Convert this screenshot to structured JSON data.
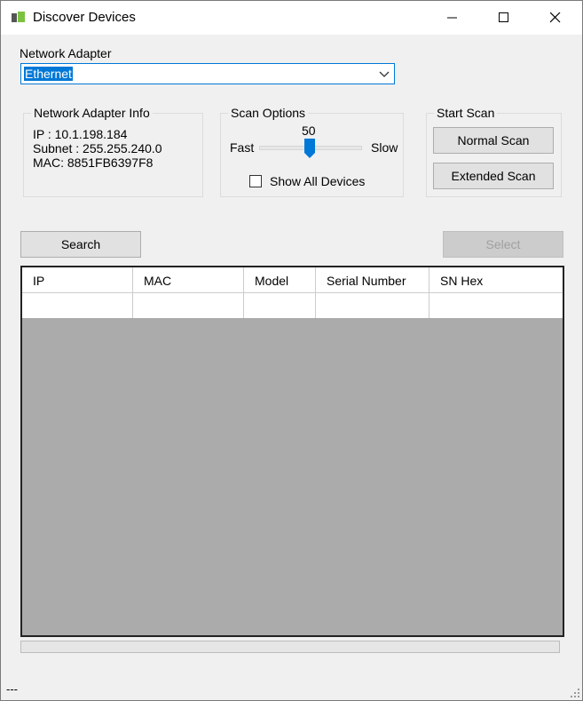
{
  "window": {
    "title": "Discover Devices",
    "minimize_glyph": "—",
    "maximize_glyph": "☐",
    "close_glyph": "✕"
  },
  "network_adapter": {
    "label": "Network Adapter",
    "selected": "Ethernet",
    "icon": "chevron-down-icon"
  },
  "adapter_info": {
    "title": "Network Adapter Info",
    "ip": "IP : 10.1.198.184",
    "subnet": "Subnet : 255.255.240.0",
    "mac": "MAC: 8851FB6397F8"
  },
  "scan_options": {
    "title": "Scan Options",
    "slider_value": "50",
    "slider_level": 0.5,
    "min_label": "Fast",
    "max_label": "Slow",
    "show_all_label": "Show All Devices",
    "show_all_checked": false
  },
  "start_scan": {
    "title": "Start Scan",
    "normal_label": "Normal Scan",
    "extended_label": "Extended Scan"
  },
  "actions": {
    "search_label": "Search",
    "select_label": "Select"
  },
  "grid": {
    "columns": [
      "IP",
      "MAC",
      "Model",
      "Serial Number",
      "SN Hex"
    ],
    "rows": [
      [
        "",
        "",
        "",
        "",
        ""
      ]
    ]
  },
  "progress": 0,
  "status": {
    "text": "---"
  },
  "colors": {
    "accent": "#0078d7",
    "grid_background": "#ababab",
    "window_bg": "#f0f0f0"
  }
}
